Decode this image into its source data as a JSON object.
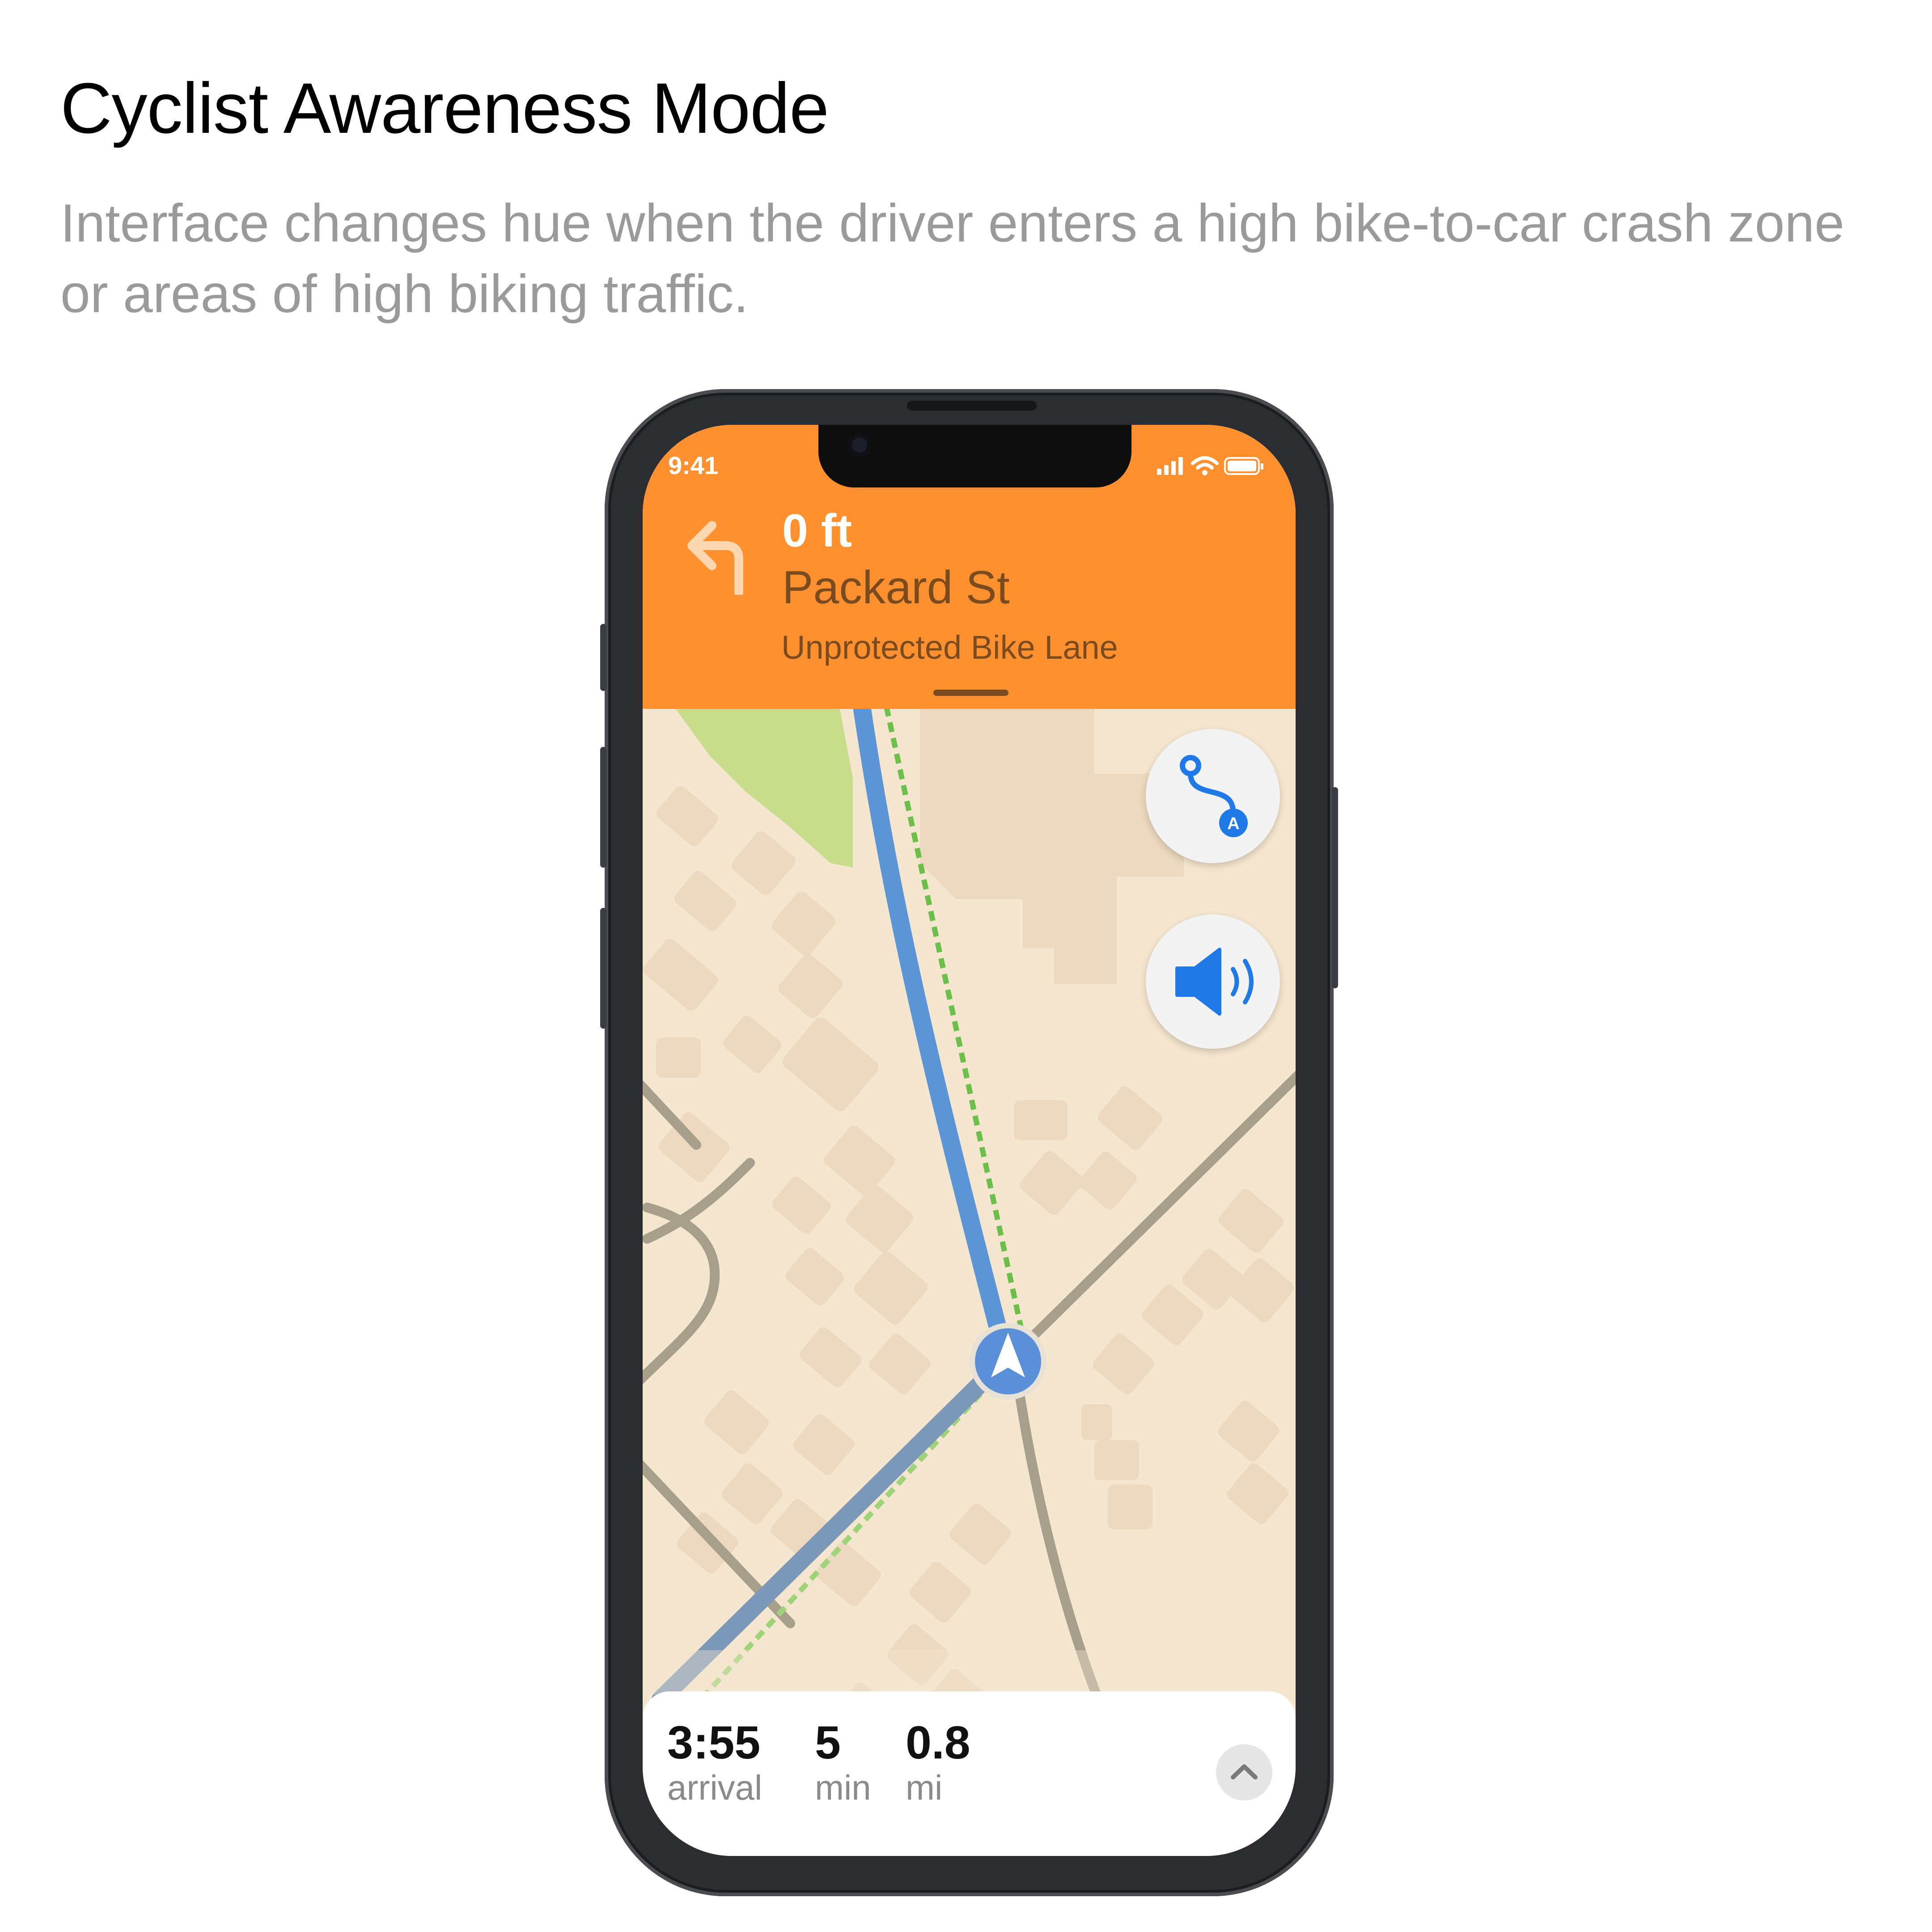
{
  "page": {
    "title": "Cyclist Awareness Mode",
    "description": "Interface changes hue when the driver enters a high bike-to-car crash zone or areas of high biking traffic."
  },
  "status_bar": {
    "time": "9:41"
  },
  "header": {
    "distance": "0 ft",
    "street": "Packard St",
    "lane_type": "Unprotected Bike Lane",
    "maneuver_icon": "turn-left-arrow-icon",
    "color": "#FF902F"
  },
  "map_controls": [
    {
      "name": "route-overview",
      "icon": "route-icon"
    },
    {
      "name": "audio",
      "icon": "speaker-icon"
    }
  ],
  "trip": {
    "arrival": {
      "value": "3:55",
      "unit": "arrival"
    },
    "minutes": {
      "value": "5",
      "unit": "min"
    },
    "distance": {
      "value": "0.8",
      "unit": "mi"
    }
  },
  "colors": {
    "route": "#5b95d6",
    "bike_lane": "#6cbf4a",
    "map_land": "#f5e6cf",
    "park": "#c8dc8c",
    "road": "#a89e8c",
    "accent_blue": "#1f7ae8"
  }
}
